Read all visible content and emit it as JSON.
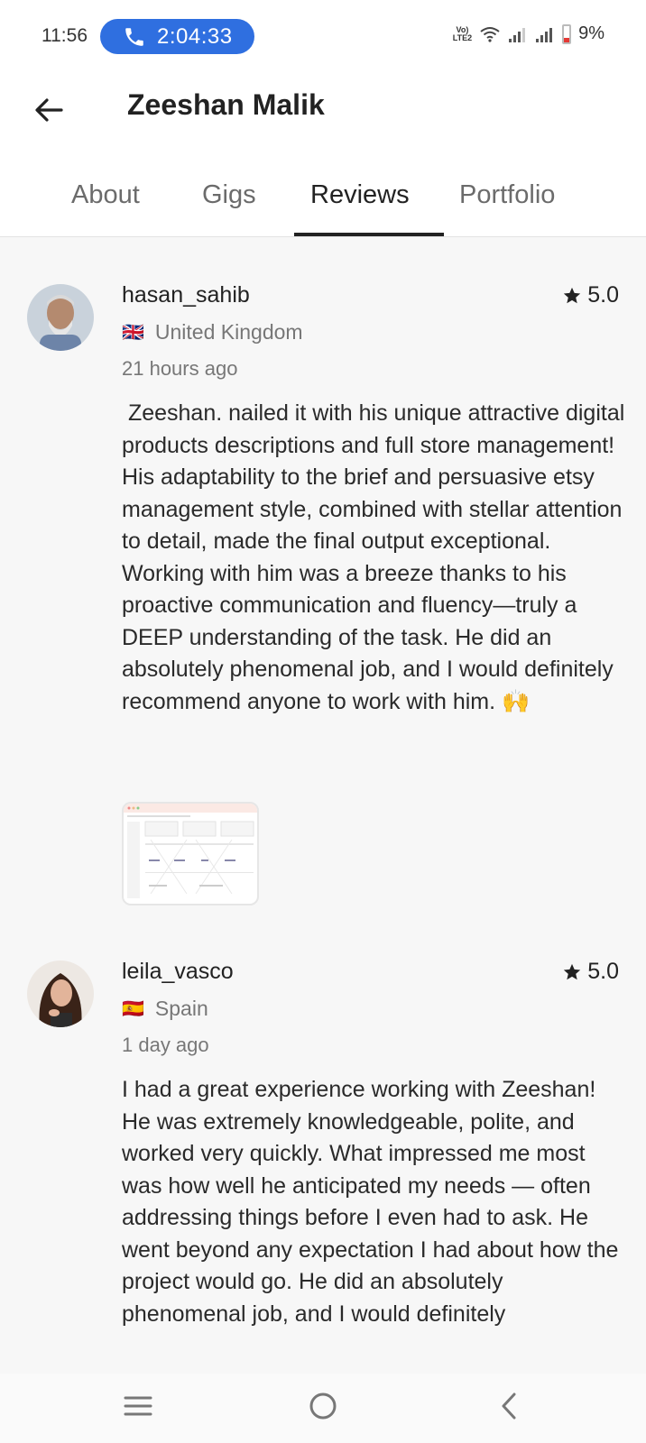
{
  "status": {
    "time": "11:56",
    "call_timer": "2:04:33",
    "volte": "Vo)) LTE2",
    "battery": "9%"
  },
  "header": {
    "title": "Zeeshan Malik",
    "back_icon": "arrow-left-icon"
  },
  "tabs": [
    {
      "label": "About",
      "active": false
    },
    {
      "label": "Gigs",
      "active": false
    },
    {
      "label": "Reviews",
      "active": true
    },
    {
      "label": "Portfolio",
      "active": false
    }
  ],
  "reviews": [
    {
      "username": "hasan_sahib",
      "rating": "5.0",
      "flag": "🇬🇧",
      "country": "United Kingdom",
      "time_ago": "21 hours ago",
      "text": " Zeeshan. nailed it with his unique attractive digital products descriptions and full store management! His adaptability to the brief and persuasive etsy management style, combined with stellar attention to detail, made the final output exceptional. Working with him was a breeze thanks to his proactive communication and fluency—truly a DEEP understanding of the task. He did an absolutely phenomenal job, and I would definitely recommend anyone to work with him. 🙌"
    },
    {
      "username": "leila_vasco",
      "rating": "5.0",
      "flag": "🇪🇸",
      "country": "Spain",
      "time_ago": "1 day ago",
      "text": "I had a great experience working with Zeeshan! He was extremely knowledgeable, polite, and worked very quickly. What impressed me most was how well he anticipated my needs — often addressing things before I even had to ask. He went beyond any expectation I had about how the project would go. He did an absolutely phenomenal job, and I would definitely"
    }
  ],
  "colors": {
    "call_pill": "#2f6fe0",
    "accent_indicator": "#222222",
    "battery_low": "#e53935"
  }
}
